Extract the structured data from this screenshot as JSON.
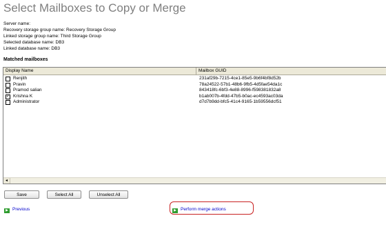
{
  "page": {
    "title": "Select Mailboxes to Copy or Merge"
  },
  "info": {
    "server_name": "Server name:",
    "recovery_storage_group": "Recovery storage group name: Recovery Storage Group",
    "linked_storage_group": "Linked storage group name: Third Storage Group",
    "selected_database": "Selected database name: DB3",
    "linked_database": "Linked database name: DB3"
  },
  "matched": {
    "title": "Matched mailboxes",
    "columns": [
      "Display Name",
      "Mailbox GUID"
    ],
    "rows": [
      {
        "name": "Renjith",
        "guid": "231af29b-7215-4ce1-85e5-9b6f4bf8d52b",
        "checked": false
      },
      {
        "name": "Pravin",
        "guid": "78a24522-57b1-48b6-9fb5-4d5fae54da1c",
        "checked": false
      },
      {
        "name": "Pramod salian",
        "guid": "843418fc-6bf3-4e88-8996-f598381832a8",
        "checked": false
      },
      {
        "name": "Krishna K",
        "guid": "b1ab007b-4fdd-47b5-b0ac-ec4593ac03da",
        "checked": true
      },
      {
        "name": "Administrator",
        "guid": "d7d7b9dd-bfc5-41c4-9165-1b59556dcf51",
        "checked": false
      }
    ]
  },
  "buttons": {
    "save": "Save",
    "select_all": "Select All",
    "unselect_all": "Unselect All"
  },
  "nav": {
    "previous": "Previous",
    "perform_merge": "Perform merge actions",
    "arrow_icon": "green-arrow-icon",
    "arrow_color": "#2e9c2e",
    "highlight_color": "#c82020"
  }
}
